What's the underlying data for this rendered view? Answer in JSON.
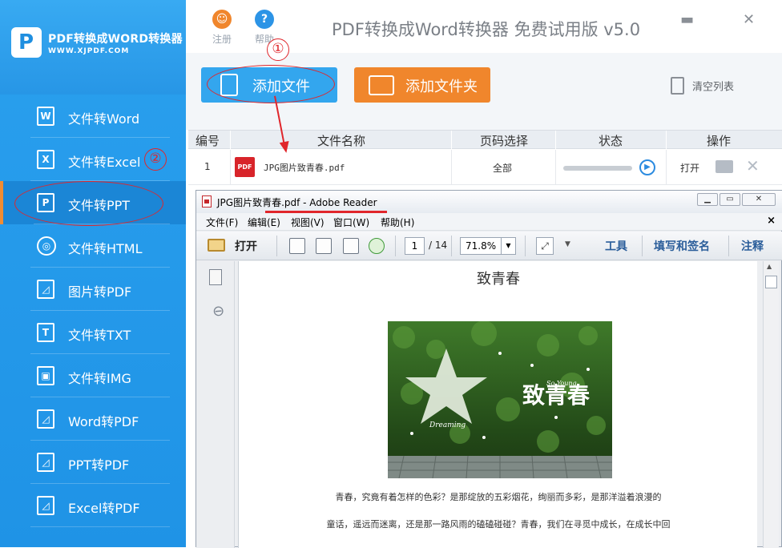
{
  "app": {
    "brand_title": "PDF转换成WORD转换器",
    "brand_url": "WWW.XJPDF.COM",
    "title": "PDF转换成Word转换器 免费试用版 v5.0",
    "register_label": "注册",
    "help_label": "帮助"
  },
  "sidebar": {
    "items": [
      {
        "label": "文件转Word",
        "icon": "word-file-icon",
        "glyph": "W"
      },
      {
        "label": "文件转Excel",
        "icon": "excel-file-icon",
        "glyph": "X"
      },
      {
        "label": "文件转PPT",
        "icon": "ppt-file-icon",
        "glyph": "P"
      },
      {
        "label": "文件转HTML",
        "icon": "globe-icon",
        "glyph": "◎"
      },
      {
        "label": "图片转PDF",
        "icon": "pdf-file-icon",
        "glyph": "◿"
      },
      {
        "label": "文件转TXT",
        "icon": "txt-file-icon",
        "glyph": "T"
      },
      {
        "label": "文件转IMG",
        "icon": "image-icon",
        "glyph": "▣"
      },
      {
        "label": "Word转PDF",
        "icon": "pdf-file-icon",
        "glyph": "◿"
      },
      {
        "label": "PPT转PDF",
        "icon": "pdf-file-icon",
        "glyph": "◿"
      },
      {
        "label": "Excel转PDF",
        "icon": "pdf-file-icon",
        "glyph": "◿"
      }
    ],
    "active_index": 2
  },
  "annotations": {
    "circle_1": "①",
    "circle_2": "②"
  },
  "toolbar": {
    "add_file_label": "添加文件",
    "add_folder_label": "添加文件夹",
    "clear_list_label": "清空列表"
  },
  "table": {
    "headers": [
      "编号",
      "文件名称",
      "页码选择",
      "状态",
      "操作"
    ],
    "rows": [
      {
        "index": "1",
        "filename": "JPG图片致青春.pdf",
        "pages": "全部",
        "progress": 0,
        "action_open": "打开"
      }
    ]
  },
  "reader": {
    "window_title": "JPG图片致青春.pdf - Adobe Reader",
    "menu": [
      "文件(F)",
      "编辑(E)",
      "视图(V)",
      "窗口(W)",
      "帮助(H)"
    ],
    "open_label": "打开",
    "page_current": "1",
    "page_total": "/ 14",
    "zoom": "71.8%",
    "tools_label": "工具",
    "fill_sign_label": "填写和签名",
    "comment_label": "注释",
    "doc_title": "致青春",
    "poster_title": "致青春",
    "poster_subtitle": "So Young",
    "poster_script": "Dreaming",
    "para1": "青春，究竟有着怎样的色彩？是那绽放的五彩烟花，绚丽而多彩，是那洋溢着浪漫的",
    "para2": "童话，遥远而迷离，还是那一路风雨的磕磕碰碰？青春，我们在寻觅中成长，在成长中回"
  },
  "colors": {
    "sidebar_blue": "#2aa0ee",
    "accent_orange": "#f0862c",
    "add_blue": "#33a6ee",
    "annotation_red": "#e0262b"
  }
}
